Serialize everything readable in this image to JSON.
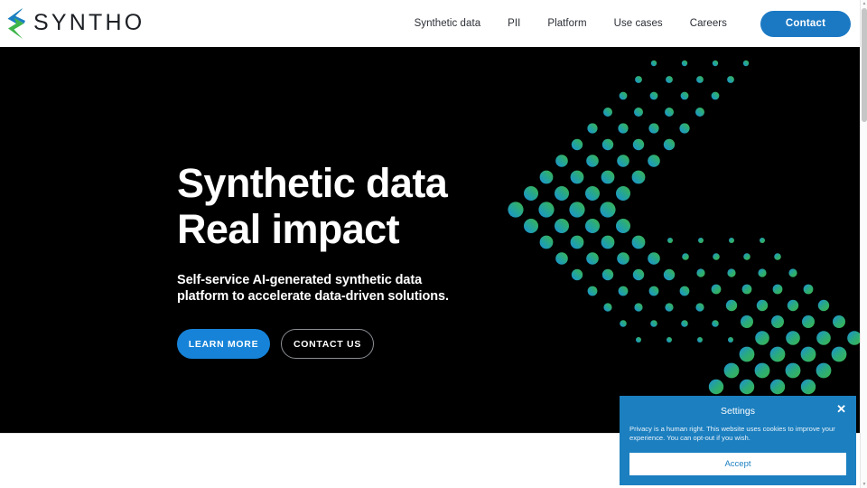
{
  "brand": {
    "name": "SYNTHO",
    "logo_colors": {
      "blue": "#1b7fc4",
      "green": "#3db54a"
    }
  },
  "nav": {
    "items": [
      {
        "label": "Synthetic data",
        "name": "synthetic-data"
      },
      {
        "label": "PII",
        "name": "pii"
      },
      {
        "label": "Platform",
        "name": "platform"
      },
      {
        "label": "Use cases",
        "name": "use-cases"
      },
      {
        "label": "Careers",
        "name": "careers"
      }
    ],
    "cta": {
      "label": "Contact",
      "color": "#1b79c4"
    }
  },
  "hero": {
    "title": "Synthetic data\nReal impact",
    "subtitle": "Self-service AI-generated synthetic data platform to accelerate data-driven solutions.",
    "primary_button": {
      "label": "LEARN MORE",
      "color": "#1683d8"
    },
    "secondary_button": {
      "label": "CONTACT US",
      "color": "#000000"
    },
    "background": "#000000",
    "graphic": {
      "name": "chevron-dot-pattern",
      "gradient_from": "#1b9ad8",
      "gradient_to": "#3db54a"
    }
  },
  "cookie_dialog": {
    "title": "Settings",
    "close_label": "✕",
    "body": "Privacy is a human right. This website uses cookies to improve your experience. You can opt-out if you wish.",
    "accept_label": "Accept",
    "background": "#1b7fc0"
  }
}
